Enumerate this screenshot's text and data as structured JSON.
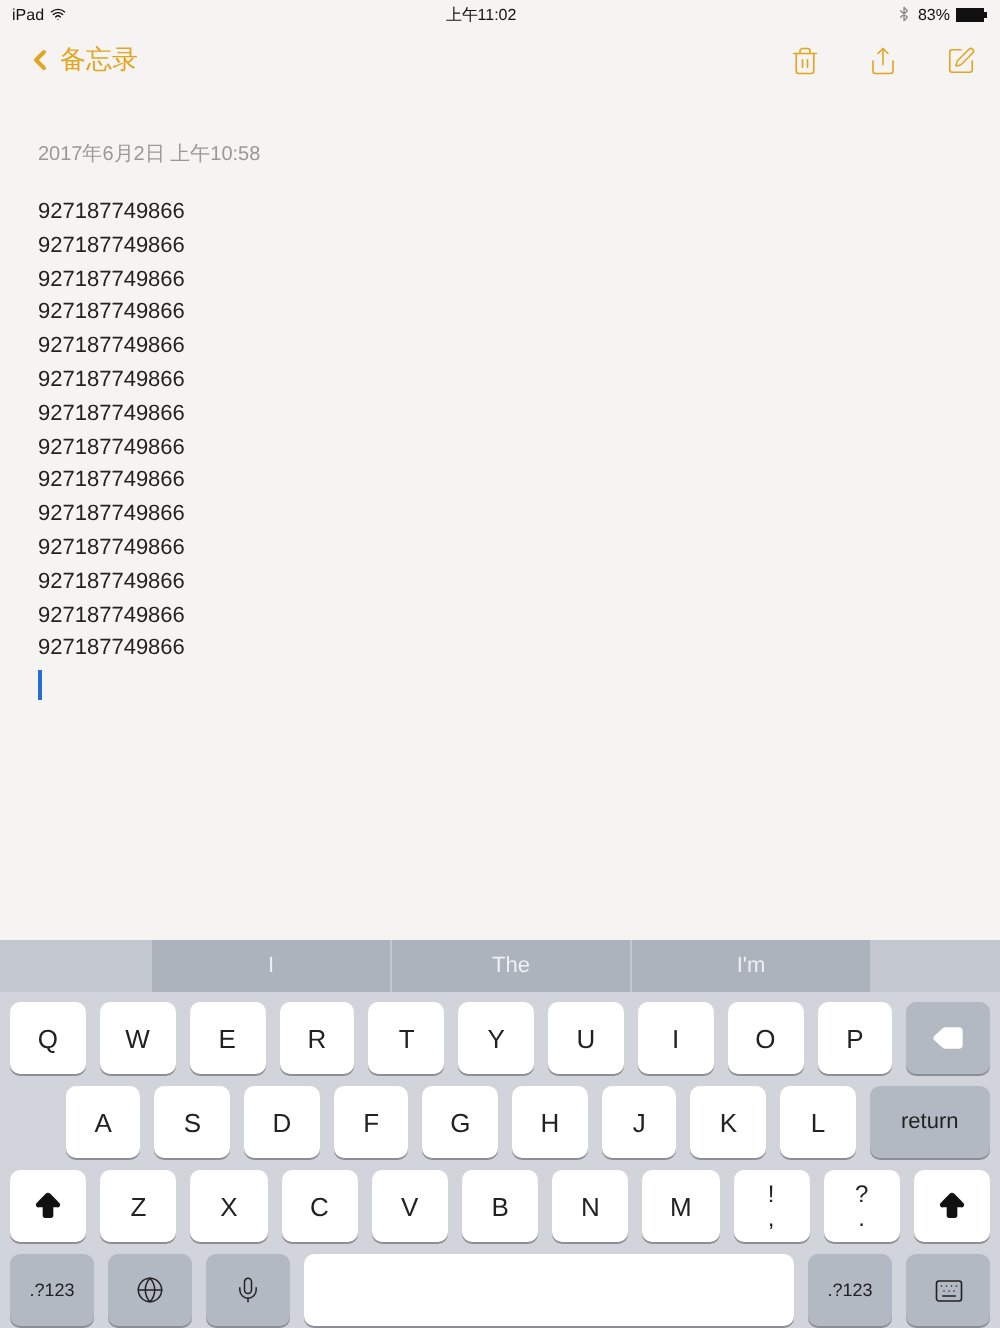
{
  "status_bar": {
    "device": "iPad",
    "time": "上午11:02",
    "battery": "83%"
  },
  "nav": {
    "back": "备忘录"
  },
  "note": {
    "date": "2017年6月2日 上午10:58",
    "lines": [
      "927187749866",
      "927187749866",
      "927187749866",
      "927187749866",
      "927187749866",
      "927187749866",
      "927187749866",
      "927187749866",
      "927187749866",
      "927187749866",
      "927187749866",
      "927187749866",
      "927187749866",
      "927187749866"
    ]
  },
  "suggestions": [
    "I",
    "The",
    "I'm"
  ],
  "keyboard": {
    "top_row": [
      {
        "kind": "letter",
        "label": "Q"
      },
      {
        "kind": "letter",
        "label": "W"
      },
      {
        "kind": "letter",
        "label": "E"
      },
      {
        "kind": "letter",
        "label": "R"
      },
      {
        "kind": "letter",
        "label": "T"
      },
      {
        "kind": "letter",
        "label": "Y"
      },
      {
        "kind": "letter",
        "label": "U"
      },
      {
        "kind": "letter",
        "label": "I"
      },
      {
        "kind": "letter",
        "label": "O"
      },
      {
        "kind": "letter",
        "label": "P"
      },
      {
        "kind": "delete"
      }
    ],
    "home_row": [
      {
        "kind": "indent"
      },
      {
        "kind": "letter",
        "label": "A"
      },
      {
        "kind": "letter",
        "label": "S"
      },
      {
        "kind": "letter",
        "label": "D"
      },
      {
        "kind": "letter",
        "label": "F"
      },
      {
        "kind": "letter",
        "label": "G"
      },
      {
        "kind": "letter",
        "label": "H"
      },
      {
        "kind": "letter",
        "label": "J"
      },
      {
        "kind": "letter",
        "label": "K"
      },
      {
        "kind": "letter",
        "label": "L"
      },
      {
        "kind": "return",
        "label": "return"
      }
    ],
    "shift_row": [
      {
        "kind": "shift"
      },
      {
        "kind": "letter",
        "label": "Z"
      },
      {
        "kind": "letter",
        "label": "X"
      },
      {
        "kind": "letter",
        "label": "C"
      },
      {
        "kind": "letter",
        "label": "V"
      },
      {
        "kind": "letter",
        "label": "B"
      },
      {
        "kind": "letter",
        "label": "N"
      },
      {
        "kind": "letter",
        "label": "M"
      },
      {
        "kind": "dual",
        "top": "!",
        "bottom": ","
      },
      {
        "kind": "dual",
        "top": "?",
        "bottom": "."
      },
      {
        "kind": "shift"
      }
    ],
    "function_row": [
      {
        "kind": "mode",
        "label": ".?123"
      },
      {
        "kind": "globe"
      },
      {
        "kind": "mic"
      },
      {
        "kind": "space"
      },
      {
        "kind": "mode",
        "label": ".?123"
      },
      {
        "kind": "hide"
      }
    ]
  }
}
